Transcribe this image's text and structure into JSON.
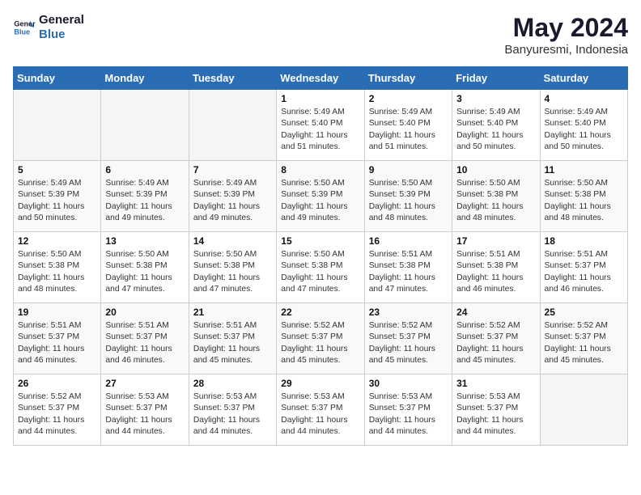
{
  "logo": {
    "line1": "General",
    "line2": "Blue"
  },
  "title": "May 2024",
  "subtitle": "Banyuresmi, Indonesia",
  "days_of_week": [
    "Sunday",
    "Monday",
    "Tuesday",
    "Wednesday",
    "Thursday",
    "Friday",
    "Saturday"
  ],
  "weeks": [
    [
      {
        "day": "",
        "content": ""
      },
      {
        "day": "",
        "content": ""
      },
      {
        "day": "",
        "content": ""
      },
      {
        "day": "1",
        "content": "Sunrise: 5:49 AM\nSunset: 5:40 PM\nDaylight: 11 hours\nand 51 minutes."
      },
      {
        "day": "2",
        "content": "Sunrise: 5:49 AM\nSunset: 5:40 PM\nDaylight: 11 hours\nand 51 minutes."
      },
      {
        "day": "3",
        "content": "Sunrise: 5:49 AM\nSunset: 5:40 PM\nDaylight: 11 hours\nand 50 minutes."
      },
      {
        "day": "4",
        "content": "Sunrise: 5:49 AM\nSunset: 5:40 PM\nDaylight: 11 hours\nand 50 minutes."
      }
    ],
    [
      {
        "day": "5",
        "content": "Sunrise: 5:49 AM\nSunset: 5:39 PM\nDaylight: 11 hours\nand 50 minutes."
      },
      {
        "day": "6",
        "content": "Sunrise: 5:49 AM\nSunset: 5:39 PM\nDaylight: 11 hours\nand 49 minutes."
      },
      {
        "day": "7",
        "content": "Sunrise: 5:49 AM\nSunset: 5:39 PM\nDaylight: 11 hours\nand 49 minutes."
      },
      {
        "day": "8",
        "content": "Sunrise: 5:50 AM\nSunset: 5:39 PM\nDaylight: 11 hours\nand 49 minutes."
      },
      {
        "day": "9",
        "content": "Sunrise: 5:50 AM\nSunset: 5:39 PM\nDaylight: 11 hours\nand 48 minutes."
      },
      {
        "day": "10",
        "content": "Sunrise: 5:50 AM\nSunset: 5:38 PM\nDaylight: 11 hours\nand 48 minutes."
      },
      {
        "day": "11",
        "content": "Sunrise: 5:50 AM\nSunset: 5:38 PM\nDaylight: 11 hours\nand 48 minutes."
      }
    ],
    [
      {
        "day": "12",
        "content": "Sunrise: 5:50 AM\nSunset: 5:38 PM\nDaylight: 11 hours\nand 48 minutes."
      },
      {
        "day": "13",
        "content": "Sunrise: 5:50 AM\nSunset: 5:38 PM\nDaylight: 11 hours\nand 47 minutes."
      },
      {
        "day": "14",
        "content": "Sunrise: 5:50 AM\nSunset: 5:38 PM\nDaylight: 11 hours\nand 47 minutes."
      },
      {
        "day": "15",
        "content": "Sunrise: 5:50 AM\nSunset: 5:38 PM\nDaylight: 11 hours\nand 47 minutes."
      },
      {
        "day": "16",
        "content": "Sunrise: 5:51 AM\nSunset: 5:38 PM\nDaylight: 11 hours\nand 47 minutes."
      },
      {
        "day": "17",
        "content": "Sunrise: 5:51 AM\nSunset: 5:38 PM\nDaylight: 11 hours\nand 46 minutes."
      },
      {
        "day": "18",
        "content": "Sunrise: 5:51 AM\nSunset: 5:37 PM\nDaylight: 11 hours\nand 46 minutes."
      }
    ],
    [
      {
        "day": "19",
        "content": "Sunrise: 5:51 AM\nSunset: 5:37 PM\nDaylight: 11 hours\nand 46 minutes."
      },
      {
        "day": "20",
        "content": "Sunrise: 5:51 AM\nSunset: 5:37 PM\nDaylight: 11 hours\nand 46 minutes."
      },
      {
        "day": "21",
        "content": "Sunrise: 5:51 AM\nSunset: 5:37 PM\nDaylight: 11 hours\nand 45 minutes."
      },
      {
        "day": "22",
        "content": "Sunrise: 5:52 AM\nSunset: 5:37 PM\nDaylight: 11 hours\nand 45 minutes."
      },
      {
        "day": "23",
        "content": "Sunrise: 5:52 AM\nSunset: 5:37 PM\nDaylight: 11 hours\nand 45 minutes."
      },
      {
        "day": "24",
        "content": "Sunrise: 5:52 AM\nSunset: 5:37 PM\nDaylight: 11 hours\nand 45 minutes."
      },
      {
        "day": "25",
        "content": "Sunrise: 5:52 AM\nSunset: 5:37 PM\nDaylight: 11 hours\nand 45 minutes."
      }
    ],
    [
      {
        "day": "26",
        "content": "Sunrise: 5:52 AM\nSunset: 5:37 PM\nDaylight: 11 hours\nand 44 minutes."
      },
      {
        "day": "27",
        "content": "Sunrise: 5:53 AM\nSunset: 5:37 PM\nDaylight: 11 hours\nand 44 minutes."
      },
      {
        "day": "28",
        "content": "Sunrise: 5:53 AM\nSunset: 5:37 PM\nDaylight: 11 hours\nand 44 minutes."
      },
      {
        "day": "29",
        "content": "Sunrise: 5:53 AM\nSunset: 5:37 PM\nDaylight: 11 hours\nand 44 minutes."
      },
      {
        "day": "30",
        "content": "Sunrise: 5:53 AM\nSunset: 5:37 PM\nDaylight: 11 hours\nand 44 minutes."
      },
      {
        "day": "31",
        "content": "Sunrise: 5:53 AM\nSunset: 5:37 PM\nDaylight: 11 hours\nand 44 minutes."
      },
      {
        "day": "",
        "content": ""
      }
    ]
  ]
}
